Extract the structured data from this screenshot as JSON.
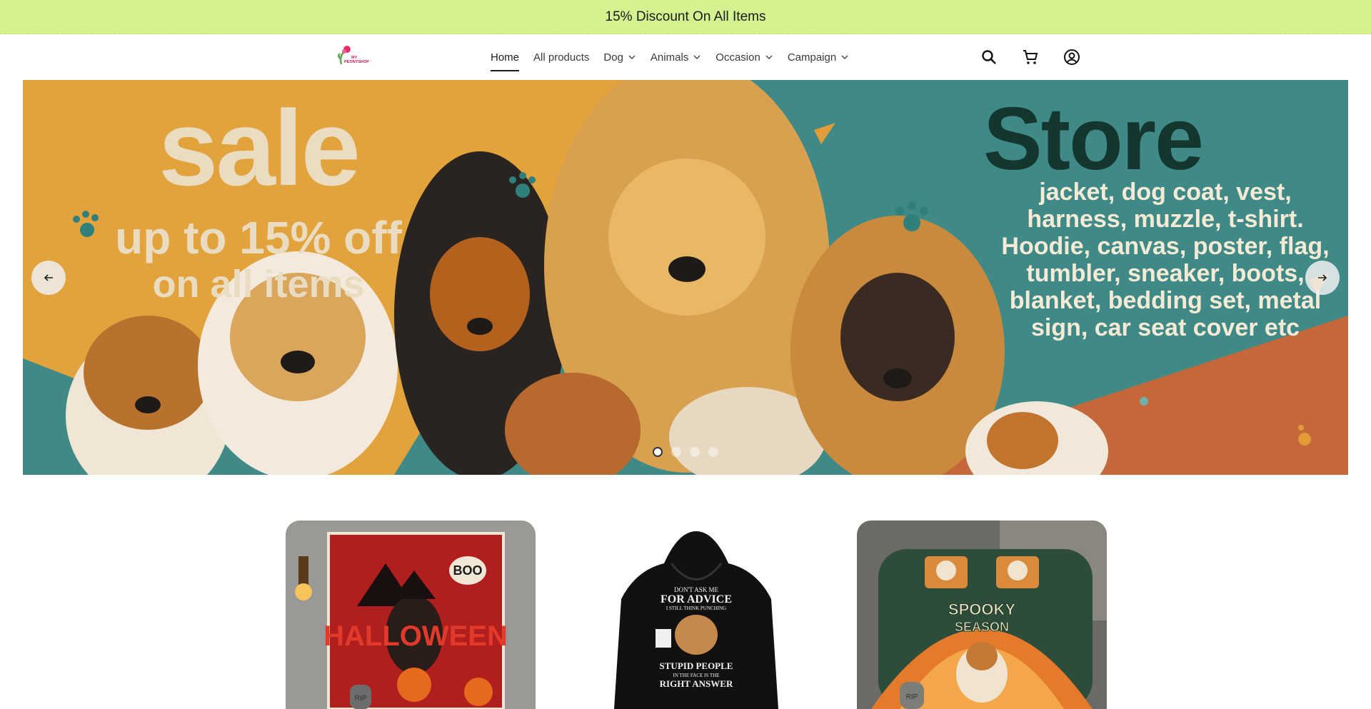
{
  "announcement": {
    "text": "15% Discount On All Items"
  },
  "header": {
    "logo_text": "MY PEONYSHOP",
    "nav": [
      {
        "label": "Home",
        "active": true,
        "dropdown": false
      },
      {
        "label": "All products",
        "active": false,
        "dropdown": false
      },
      {
        "label": "Dog",
        "active": false,
        "dropdown": true
      },
      {
        "label": "Animals",
        "active": false,
        "dropdown": true
      },
      {
        "label": "Occasion",
        "active": false,
        "dropdown": true
      },
      {
        "label": "Campaign",
        "active": false,
        "dropdown": true
      }
    ],
    "icons": [
      "search-icon",
      "cart-icon",
      "account-icon"
    ]
  },
  "hero": {
    "sale_word": "sale",
    "offer_line": "up to 15% off",
    "offer_line2": "on all items",
    "store_word": "Store",
    "store_list": "jacket, dog coat, vest, harness, muzzle, t-shirt. Hoodie, canvas, poster, flag, tumbler, sneaker, boots, blanket, bedding set, metal sign, car seat cover etc",
    "slide_count": 4,
    "active_slide": 1,
    "colors": {
      "orange": "#e2a23c",
      "teal": "#3f8a86",
      "rust": "#c4673a"
    }
  },
  "products": [
    {
      "name": "halloween-blanket",
      "text_boo": "BOO",
      "text_main": "HALLOWEEN",
      "text_rip": "RIP"
    },
    {
      "name": "hoodie",
      "text_top": "DON'T ASK ME",
      "text_mid": "FOR ADVICE",
      "text_small": "I STILL THINK PUNCHING",
      "text_bottom": "STUPID PEOPLE",
      "text_bottom2": "IN THE FACE IS THE",
      "text_bottom3": "RIGHT ANSWER"
    },
    {
      "name": "bedding-set",
      "text_main": "SPOOKY",
      "text_sub": "SEASON",
      "text_rip": "RIP"
    }
  ]
}
